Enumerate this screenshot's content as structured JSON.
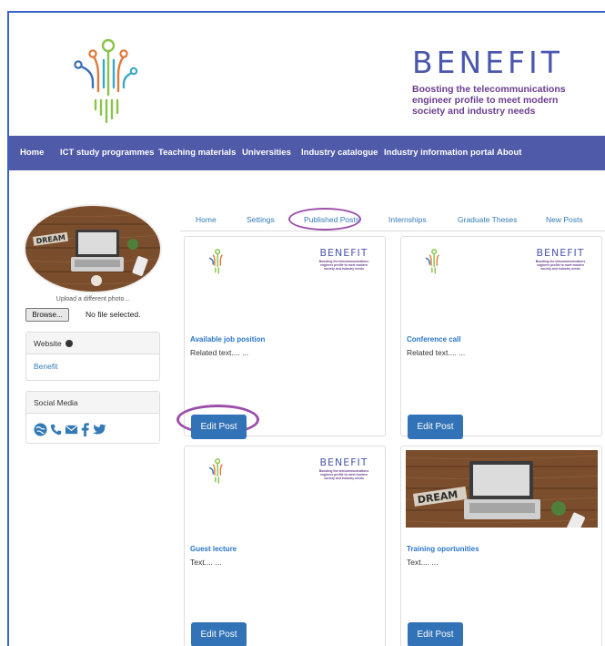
{
  "brand": {
    "name": "BENEFIT",
    "tagline_lines": [
      "Boosting the telecommunications",
      "engineer profile to meet modern",
      "society and industry needs"
    ]
  },
  "nav": {
    "items": [
      "Home",
      "ICT study programmes",
      "Teaching materials",
      "Universities",
      "Industry catalogue",
      "Industry information portal",
      "About"
    ]
  },
  "sidebar": {
    "upload_label": "Upload a different photo...",
    "browse_label": "Browse...",
    "file_status": "No file selected.",
    "website": {
      "heading": "Website",
      "link": "Benefit"
    },
    "social": {
      "heading": "Social Media",
      "icons": [
        "globe-icon",
        "phone-icon",
        "mail-icon",
        "facebook-icon",
        "twitter-icon"
      ]
    }
  },
  "tabs": [
    "Home",
    "Settings",
    "Published Posts",
    "Internships",
    "Graduate Theses",
    "New Posts"
  ],
  "posts": [
    {
      "title": "Available job position",
      "text": "Related text.... ...",
      "button": "Edit Post",
      "thumb": "logo"
    },
    {
      "title": "Conference call",
      "text": "Related text.... ...",
      "button": "Edit Post",
      "thumb": "logo"
    },
    {
      "title": "Guest lecture",
      "text": "Text.... ...",
      "button": "Edit Post",
      "thumb": "logo"
    },
    {
      "title": "Training oportunities",
      "text": "Text.... ...",
      "button": "Edit Post",
      "thumb": "photo"
    }
  ],
  "colors": {
    "nav_bg": "#4f5aa8",
    "brand": "#4b57ad",
    "tagline": "#6b3e8e",
    "button": "#3272b7",
    "highlight": "#9b4fa8"
  }
}
